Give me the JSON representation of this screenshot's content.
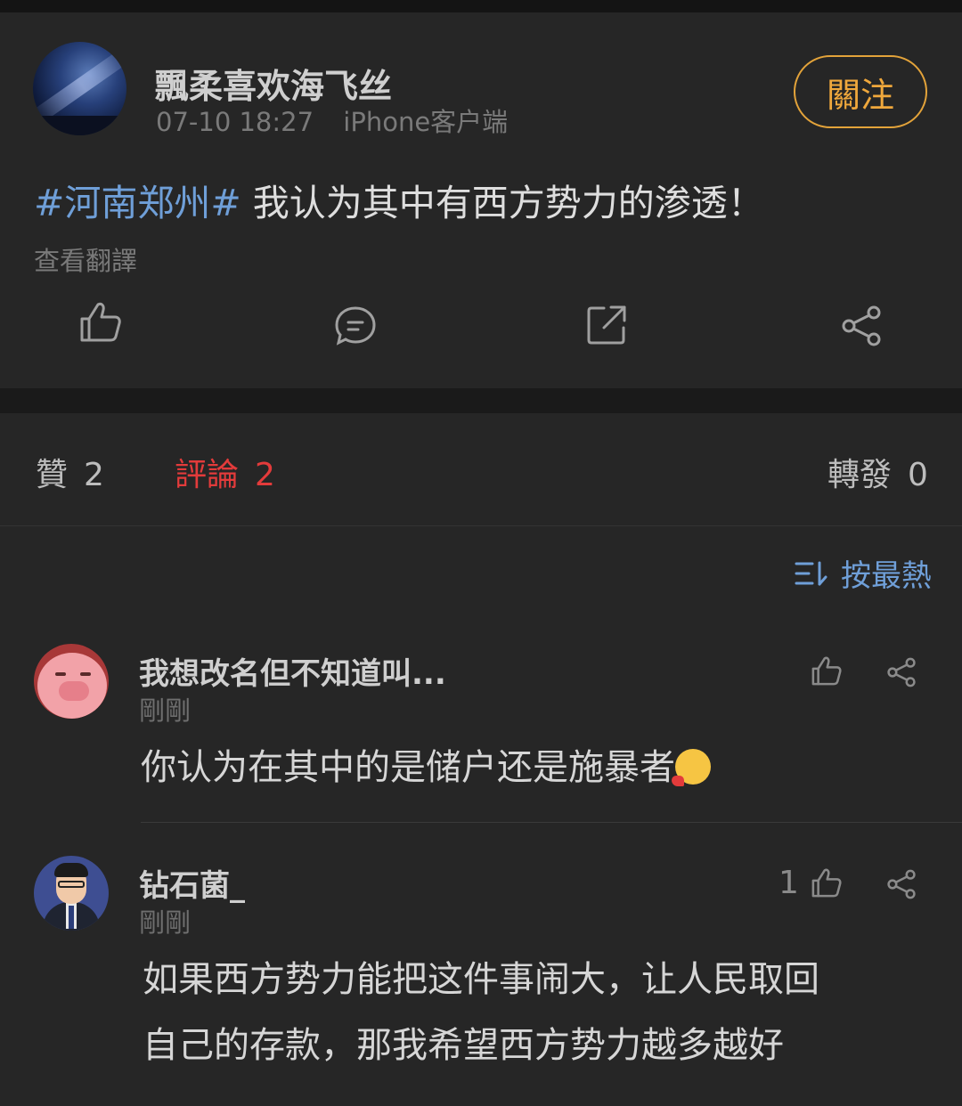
{
  "post": {
    "author": "飄柔喜欢海飞丝",
    "time": "07-10 18:27",
    "client": "iPhone客户端",
    "follow_label": "關注",
    "hashtag": "#河南郑州#",
    "text": " 我认为其中有西方势力的渗透！",
    "translate_label": "查看翻譯"
  },
  "stats": {
    "likes_label": "贊",
    "likes_count": "2",
    "comments_label": "評論",
    "comments_count": "2",
    "reposts_label": "轉發",
    "reposts_count": "0"
  },
  "comments_section": {
    "sort_label": "按最熱",
    "items": [
      {
        "author": "我想改名但不知道叫...",
        "time": "剛剛",
        "text": "你认为在其中的是储户还是施暴者",
        "likes": ""
      },
      {
        "author": "钻石菌_",
        "time": "剛剛",
        "text_line1": "如果西方势力能把这件事闹大，让人民取回",
        "text_line2": "自己的存款，那我希望西方势力越多越好",
        "likes": "1"
      }
    ]
  },
  "colors": {
    "accent_blue": "#6f9fd8",
    "active_red": "#e33b3b",
    "follow_orange": "#f0a83c"
  }
}
